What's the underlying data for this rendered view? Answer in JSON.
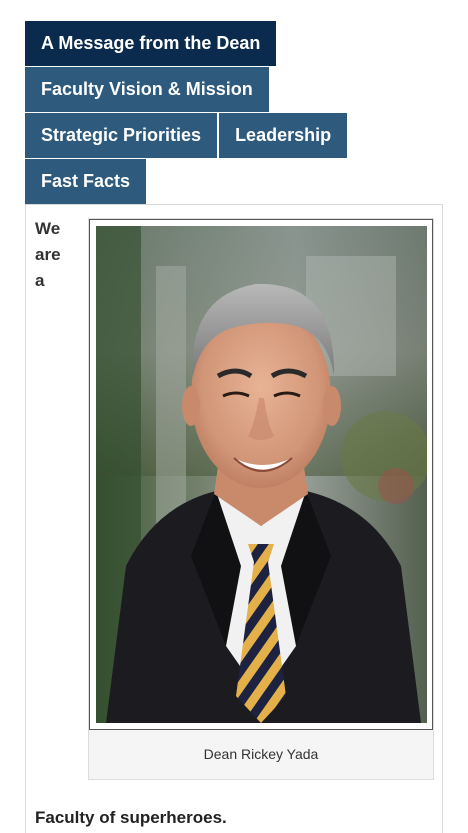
{
  "tabs": {
    "message_from_dean": "A Message from the Dean",
    "vision_mission": "Faculty Vision & Mission",
    "strategic_priorities": "Strategic Priorities",
    "leadership": "Leadership",
    "fast_facts": "Fast Facts"
  },
  "content": {
    "intro_words": [
      "We",
      "are",
      "a"
    ],
    "image_alt": "Dean Rickey Yada",
    "caption": "Dean Rickey Yada",
    "heading": "Faculty of superheroes."
  },
  "colors": {
    "tab_background": "#2e5b7d",
    "tab_active_background": "#0b2b4e",
    "tab_text": "#ffffff"
  }
}
